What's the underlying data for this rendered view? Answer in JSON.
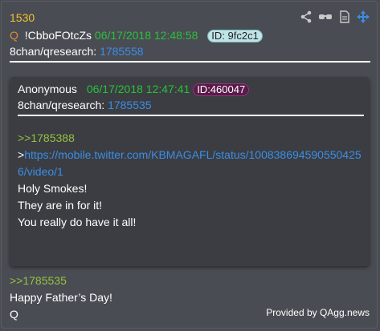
{
  "post": {
    "number": "1530",
    "trip_prefix": "Q",
    "tripcode": "!CbboFOtcZs",
    "timestamp": "06/17/2018 12:48:58",
    "id_label": "ID: 9fc2c1",
    "board": "8chan/qresearch:",
    "post_link": "1785558",
    "reply_quote": ">>1785535",
    "body_lines": [
      "Happy Father’s Day!",
      "Q"
    ]
  },
  "quoted": {
    "author": "Anonymous",
    "timestamp": "06/17/2018 12:47:41",
    "id_label": "ID:460047",
    "board": "8chan/qresearch:",
    "post_link": "1785535",
    "reply_quote": ">>1785388",
    "url_prefix": ">",
    "url_line1": "https://mobile.twitter.com/KBMAGAFL/status/100838694590550425",
    "url_line2": "6/video/1",
    "body_lines": [
      "Holy Smokes!",
      "They are in for it!",
      "You really do have it all!"
    ]
  },
  "toolbar": {
    "icons": [
      "share-icon",
      "glasses-icon",
      "document-icon",
      "move-icon"
    ],
    "accent": "#3b8ee6"
  },
  "footer": {
    "credit": "Provided by QAgg.news"
  }
}
